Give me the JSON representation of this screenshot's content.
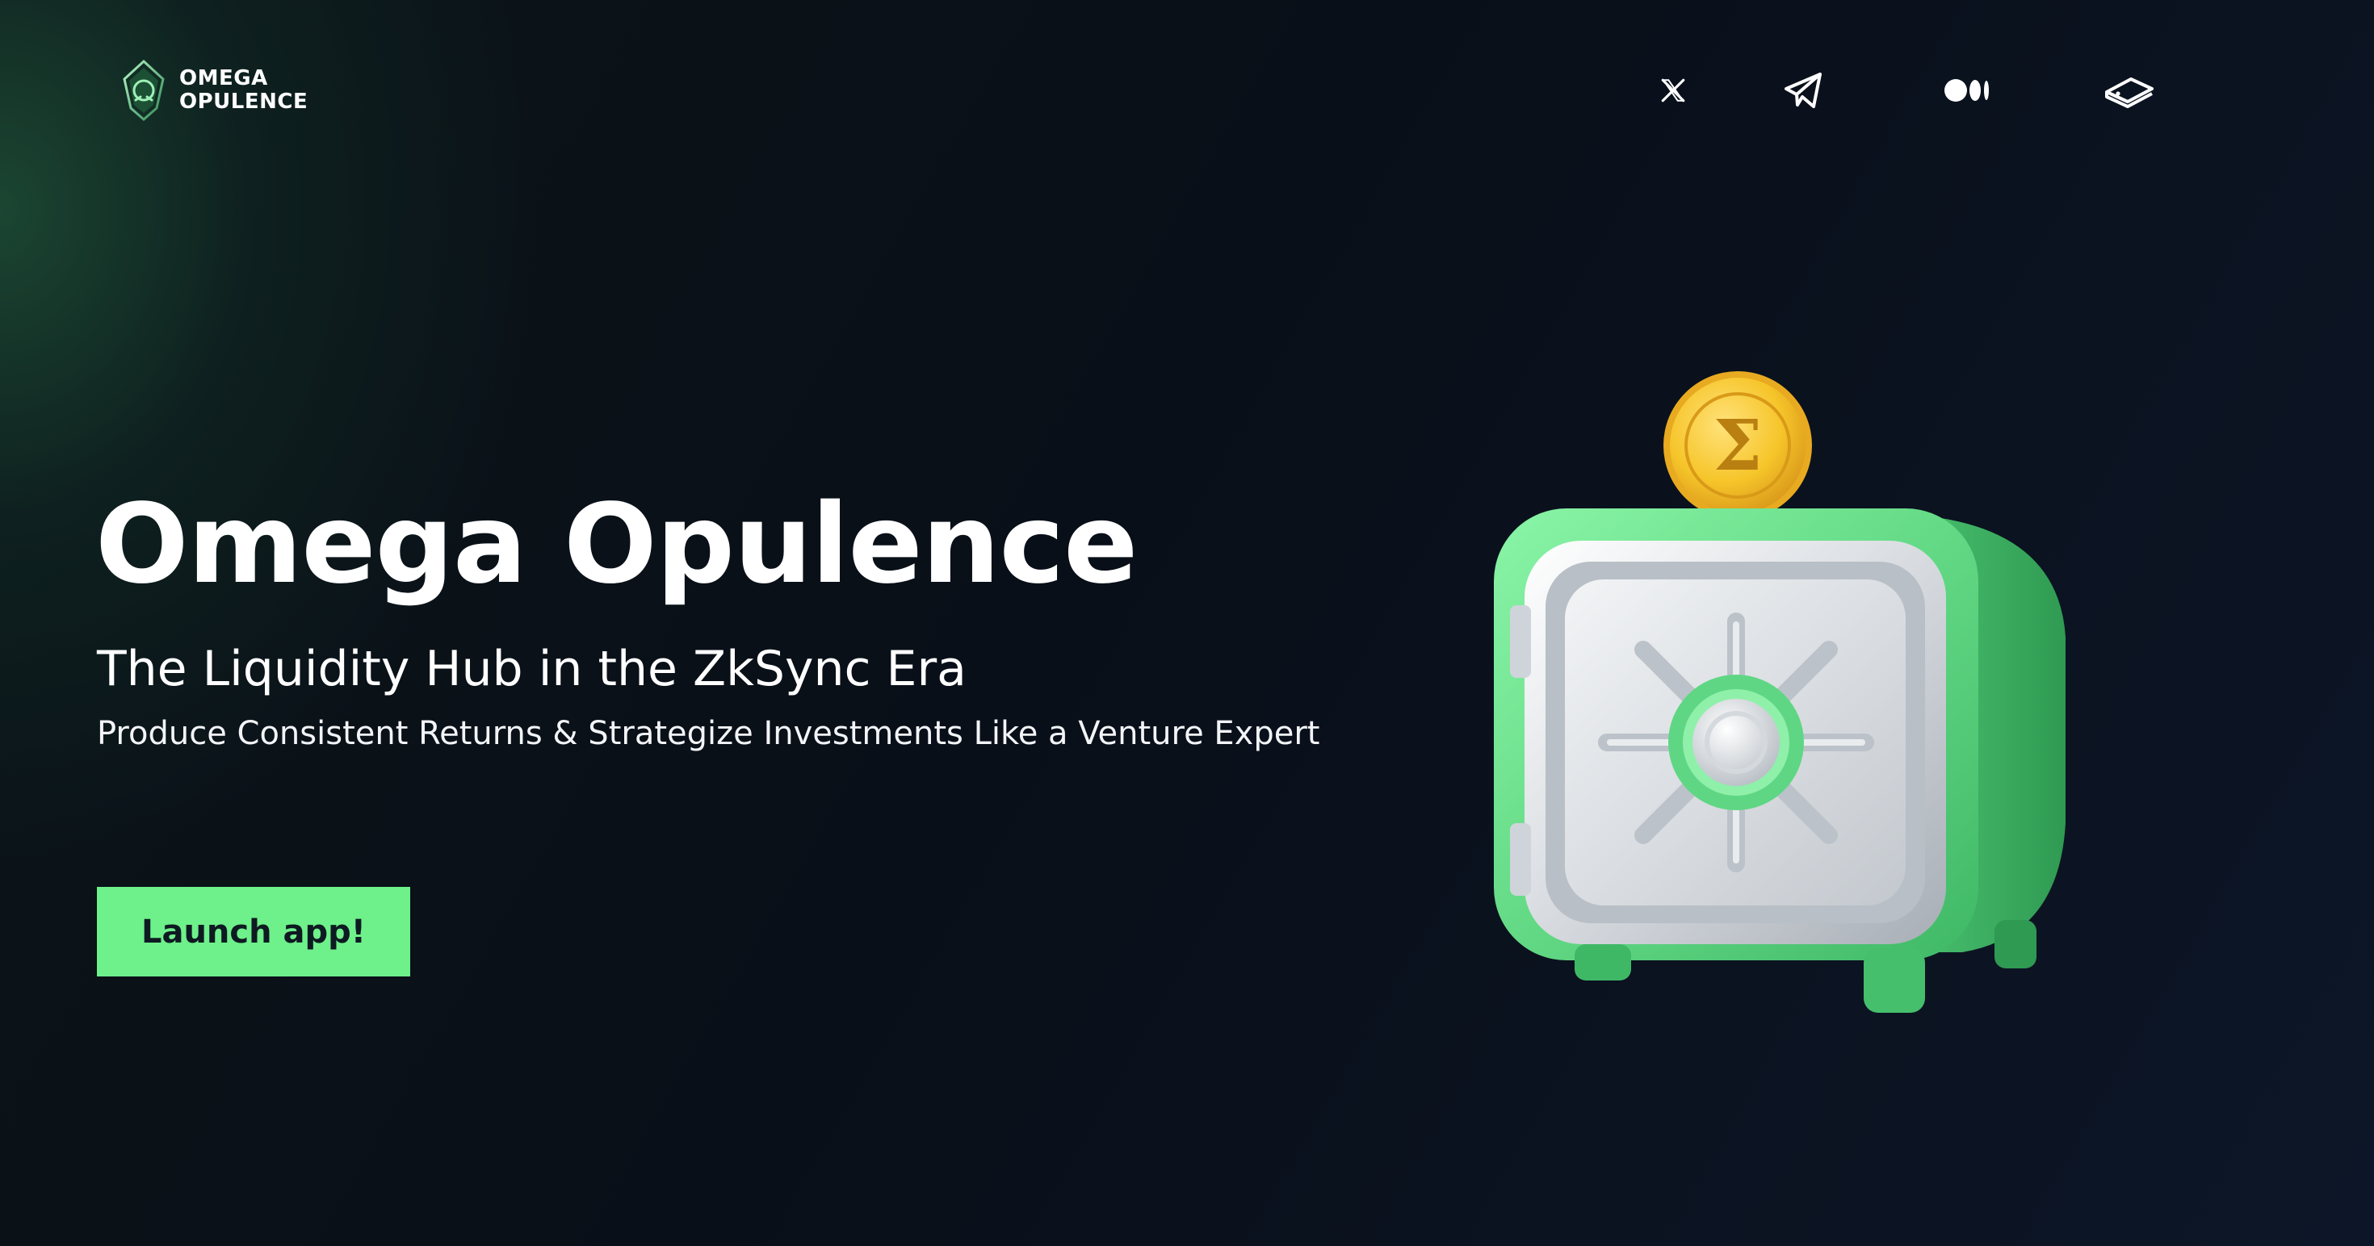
{
  "brand": {
    "name_line1": "OMEGA",
    "name_line2": "OPULENCE",
    "logo_icon": "omega-gem-logo"
  },
  "socials": [
    {
      "name": "x-icon",
      "label": "X"
    },
    {
      "name": "telegram-icon",
      "label": "Telegram"
    },
    {
      "name": "medium-icon",
      "label": "Medium"
    },
    {
      "name": "gitbook-icon",
      "label": "GitBook"
    }
  ],
  "hero": {
    "title": "Omega Opulence",
    "subtitle": "The Liquidity Hub in the ZkSync Era",
    "tagline": "Produce Consistent Returns & Strategize Investments Like a Venture Expert",
    "cta_label": "Launch app!"
  },
  "illustration": {
    "subject": "safe-with-coin",
    "coin_symbol": "Σ"
  },
  "colors": {
    "accent": "#6ef08a",
    "background": "#0b101b",
    "coin": "#f6c52a",
    "safe_body": "#63d985"
  }
}
